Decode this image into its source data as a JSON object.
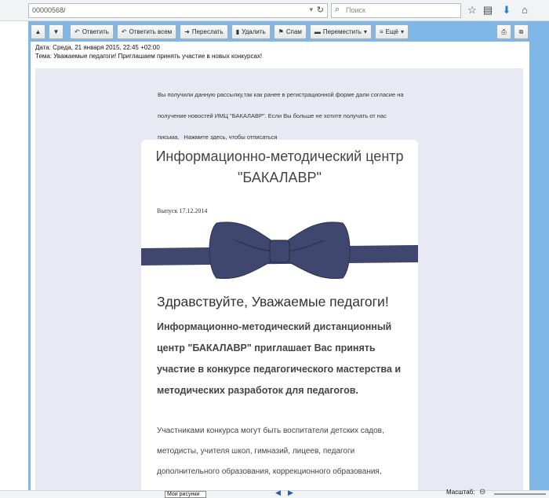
{
  "browser": {
    "url": "00000568/",
    "search_placeholder": "Поиск",
    "icons": [
      "star-icon",
      "clipboard-icon",
      "download-icon",
      "home-icon"
    ]
  },
  "mail_toolbar": {
    "buttons": [
      {
        "label": "Ответить",
        "icon": "reply-icon"
      },
      {
        "label": "Ответить всем",
        "icon": "reply-all-icon"
      },
      {
        "label": "Переслать",
        "icon": "forward-icon"
      },
      {
        "label": "Удалить",
        "icon": "trash-icon"
      },
      {
        "label": "Спам",
        "icon": "spam-icon"
      },
      {
        "label": "Переместить",
        "icon": "folder-icon"
      },
      {
        "label": "Ещё",
        "icon": "more-icon"
      }
    ]
  },
  "message": {
    "date": "Дата: Среда, 21 января 2015, 22:45 +02:00",
    "subject": "Тема: Уважаемые педагоги! Приглашаем принять участие в новых конкурсах!"
  },
  "email": {
    "intro": "Вы получили данную рассылку,так как ранее в регистрационной форме дали согласие на получение новостей ИМЦ \"БАКАЛАВР\". Если Вы больше не хотите получать от нас письма,",
    "unsubscribe": "Нажмите здесь, чтобы отписаться",
    "title_line1": "Информационно-методический центр",
    "title_line2": "\"БАКАЛАВР\"",
    "issue": "Выпуск 17.12.2014",
    "greeting": "Здравствуйте, Уважаемые педагоги!",
    "lead": "Информационно-методический дистанционный центр \"БАКАЛАВР\" приглашает Вас принять участие в конкурсе педагогического мастерства и методических разработок для педагогов.",
    "participants": "Участниками конкурса могут быть воспитатели детских садов, методисты, учителя школ, гимназий, лицеев, педагоги дополнительного образования, коррекционного образования,"
  },
  "status_bar": {
    "tab_label": "Мои рисунки",
    "zoom_label": "Масштаб:"
  },
  "colors": {
    "frame": "#7fb7e6",
    "content_bg": "#e9e9f4",
    "bow_tie": "#3b4269"
  }
}
